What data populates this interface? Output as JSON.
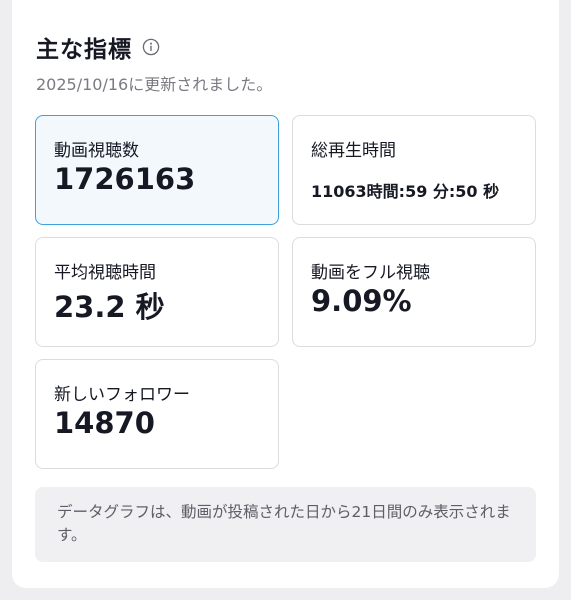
{
  "header": {
    "title": "主な指標",
    "updated": "2025/10/16に更新されました。",
    "info_icon": "info-icon"
  },
  "metrics": [
    {
      "label": "動画視聴数",
      "value": "1726163",
      "selected": true
    },
    {
      "label": "総再生時間",
      "value": "11063時間:59 分:50 秒",
      "selected": false
    },
    {
      "label": "平均視聴時間",
      "value": "23.2 秒",
      "selected": false
    },
    {
      "label": "動画をフル視聴",
      "value": "9.09%",
      "selected": false
    },
    {
      "label": "新しいフォロワー",
      "value": "14870",
      "selected": false
    }
  ],
  "notice": "データグラフは、動画が投稿された日から21日間のみ表示されます。",
  "colors": {
    "selected_border": "#3fa0dc",
    "selected_bg": "#f3f8fd",
    "text": "#161823",
    "muted": "#7a7a82"
  }
}
